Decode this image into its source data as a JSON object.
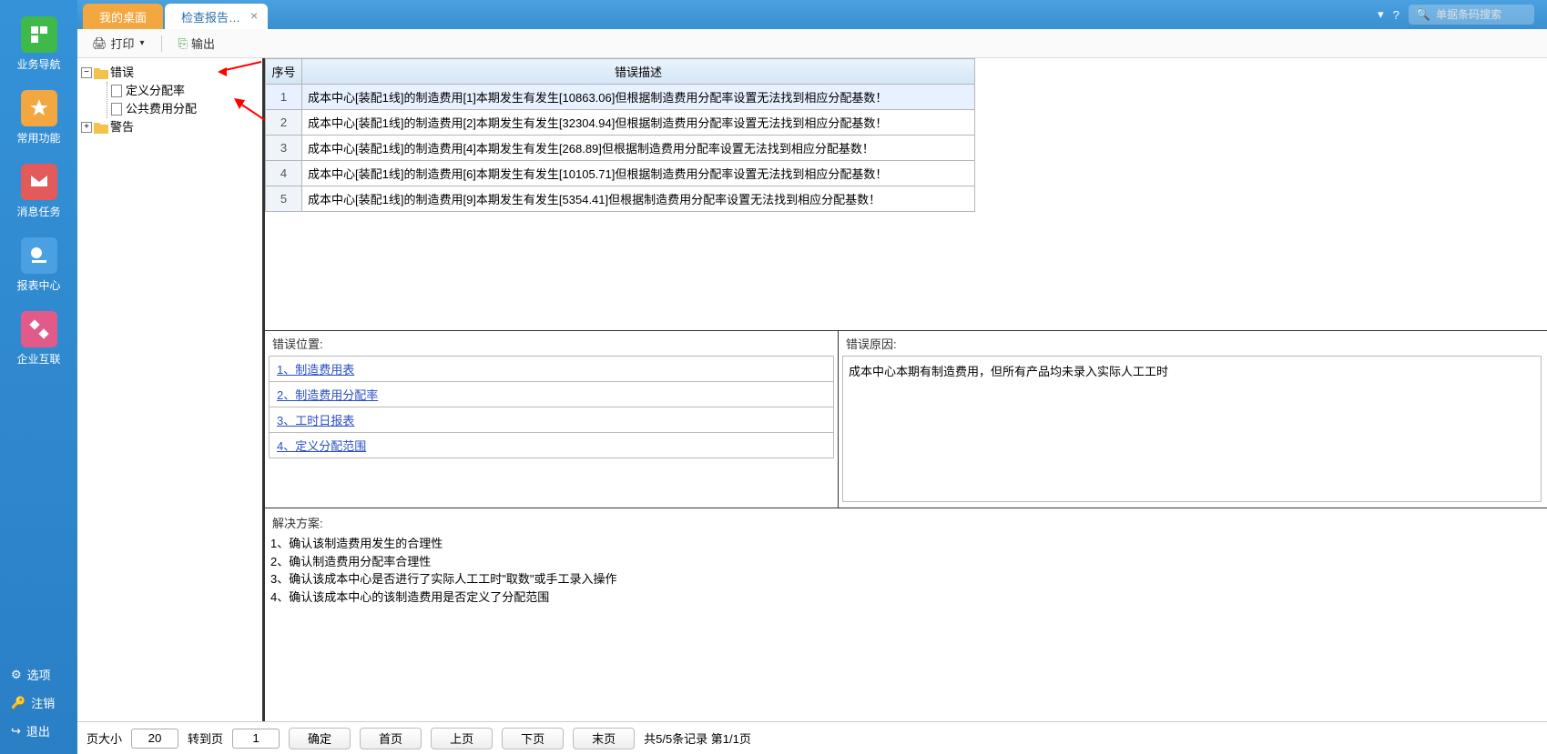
{
  "sidebar": {
    "items": [
      {
        "label": "业务导航",
        "color": "#3fb94a"
      },
      {
        "label": "常用功能",
        "color": "#f2a740"
      },
      {
        "label": "消息任务",
        "color": "#e25a5a"
      },
      {
        "label": "报表中心",
        "color": "#4aa0e0"
      },
      {
        "label": "企业互联",
        "color": "#e25a8a"
      }
    ],
    "bottom": [
      {
        "label": "选项"
      },
      {
        "label": "注销"
      },
      {
        "label": "退出"
      }
    ]
  },
  "tabs": {
    "home": "我的桌面",
    "doc": "检查报告…"
  },
  "search": {
    "placeholder": "单据条码搜索"
  },
  "toolbar": {
    "print": "打印",
    "export": "输出"
  },
  "tree": {
    "root_error": "错误",
    "child1": "定义分配率",
    "child2": "公共费用分配",
    "root_warn": "警告"
  },
  "table": {
    "col_seq": "序号",
    "col_desc": "错误描述",
    "rows": [
      {
        "n": "1",
        "desc": "成本中心[装配1线]的制造费用[1]本期发生有发生[10863.06]但根据制造费用分配率设置无法找到相应分配基数！"
      },
      {
        "n": "2",
        "desc": "成本中心[装配1线]的制造费用[2]本期发生有发生[32304.94]但根据制造费用分配率设置无法找到相应分配基数！"
      },
      {
        "n": "3",
        "desc": "成本中心[装配1线]的制造费用[4]本期发生有发生[268.89]但根据制造费用分配率设置无法找到相应分配基数！"
      },
      {
        "n": "4",
        "desc": "成本中心[装配1线]的制造费用[6]本期发生有发生[10105.71]但根据制造费用分配率设置无法找到相应分配基数！"
      },
      {
        "n": "5",
        "desc": "成本中心[装配1线]的制造费用[9]本期发生有发生[5354.41]但根据制造费用分配率设置无法找到相应分配基数！"
      }
    ]
  },
  "loc": {
    "title": "错误位置:",
    "items": [
      "1、制造费用表",
      "2、制造费用分配率",
      "3、工时日报表",
      "4、定义分配范围"
    ]
  },
  "reason": {
    "title": "错误原因:",
    "text": "成本中心本期有制造费用，但所有产品均未录入实际人工工时"
  },
  "solution": {
    "title": "解决方案:",
    "lines": [
      "1、确认该制造费用发生的合理性",
      "2、确认制造费用分配率合理性",
      "3、确认该成本中心是否进行了实际人工工时\"取数\"或手工录入操作",
      "4、确认该成本中心的该制造费用是否定义了分配范围"
    ]
  },
  "pager": {
    "page_size_label": "页大小",
    "page_size_val": "20",
    "goto_label": "转到页",
    "goto_val": "1",
    "ok": "确定",
    "first": "首页",
    "prev": "上页",
    "next": "下页",
    "last": "末页",
    "summary": "共5/5条记录 第1/1页"
  }
}
